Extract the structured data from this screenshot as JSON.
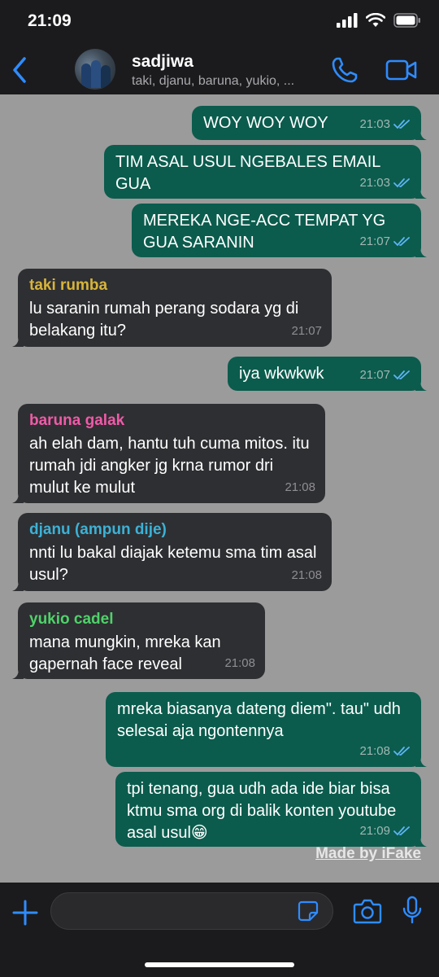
{
  "status_bar": {
    "time": "21:09"
  },
  "header": {
    "name": "sadjiwa",
    "members": "taki, djanu, baruna, yukio, ..."
  },
  "colors": {
    "accent": "#2f8cff",
    "outgoing_bubble": "#0b5c4d",
    "incoming_bubble": "#2e2f32",
    "chat_background": "#9b9b9b",
    "tick_blue": "#5eb5f7",
    "sender_taki": "#d8b43a",
    "sender_baruna": "#f05aa8",
    "sender_djanu": "#3db1d6",
    "sender_yukio": "#4fd26a"
  },
  "messages": [
    {
      "direction": "out",
      "text": "WOY WOY WOY",
      "time": "21:03",
      "status": "read"
    },
    {
      "direction": "out",
      "text": "TIM ASAL USUL NGEBALES EMAIL GUA",
      "time": "21:03",
      "status": "read"
    },
    {
      "direction": "out",
      "text": "MEREKA NGE-ACC TEMPAT YG GUA SARANIN",
      "time": "21:07",
      "status": "read"
    },
    {
      "direction": "in",
      "sender": "taki rumba",
      "text": "lu saranin rumah perang sodara yg di belakang itu?",
      "time": "21:07"
    },
    {
      "direction": "out",
      "text": "iya wkwkwk",
      "time": "21:07",
      "status": "read"
    },
    {
      "direction": "in",
      "sender": "baruna galak",
      "text": "ah elah dam, hantu tuh cuma mitos. itu rumah jdi angker jg krna rumor dri mulut ke mulut",
      "time": "21:08"
    },
    {
      "direction": "in",
      "sender": "djanu (ampun dije)",
      "text": "nnti lu bakal diajak ketemu sma tim asal usul?",
      "time": "21:08"
    },
    {
      "direction": "in",
      "sender": "yukio cadel",
      "text": "mana mungkin, mreka kan gapernah face reveal",
      "time": "21:08"
    },
    {
      "direction": "out",
      "text": "mreka biasanya dateng diem\". tau\" udh selesai aja ngontennya",
      "time": "21:08",
      "status": "read"
    },
    {
      "direction": "out",
      "text": "tpi tenang, gua udh ada ide biar bisa ktmu sma org di balik konten youtube asal usul😁",
      "time": "21:09",
      "status": "read"
    }
  ],
  "watermark": "Made by iFake",
  "input": {
    "placeholder": "",
    "value": ""
  },
  "icons": {
    "back": "chevron-left-icon",
    "call": "phone-icon",
    "video": "video-camera-icon",
    "plus": "plus-icon",
    "sticker": "sticker-icon",
    "camera": "camera-icon",
    "mic": "microphone-icon"
  }
}
